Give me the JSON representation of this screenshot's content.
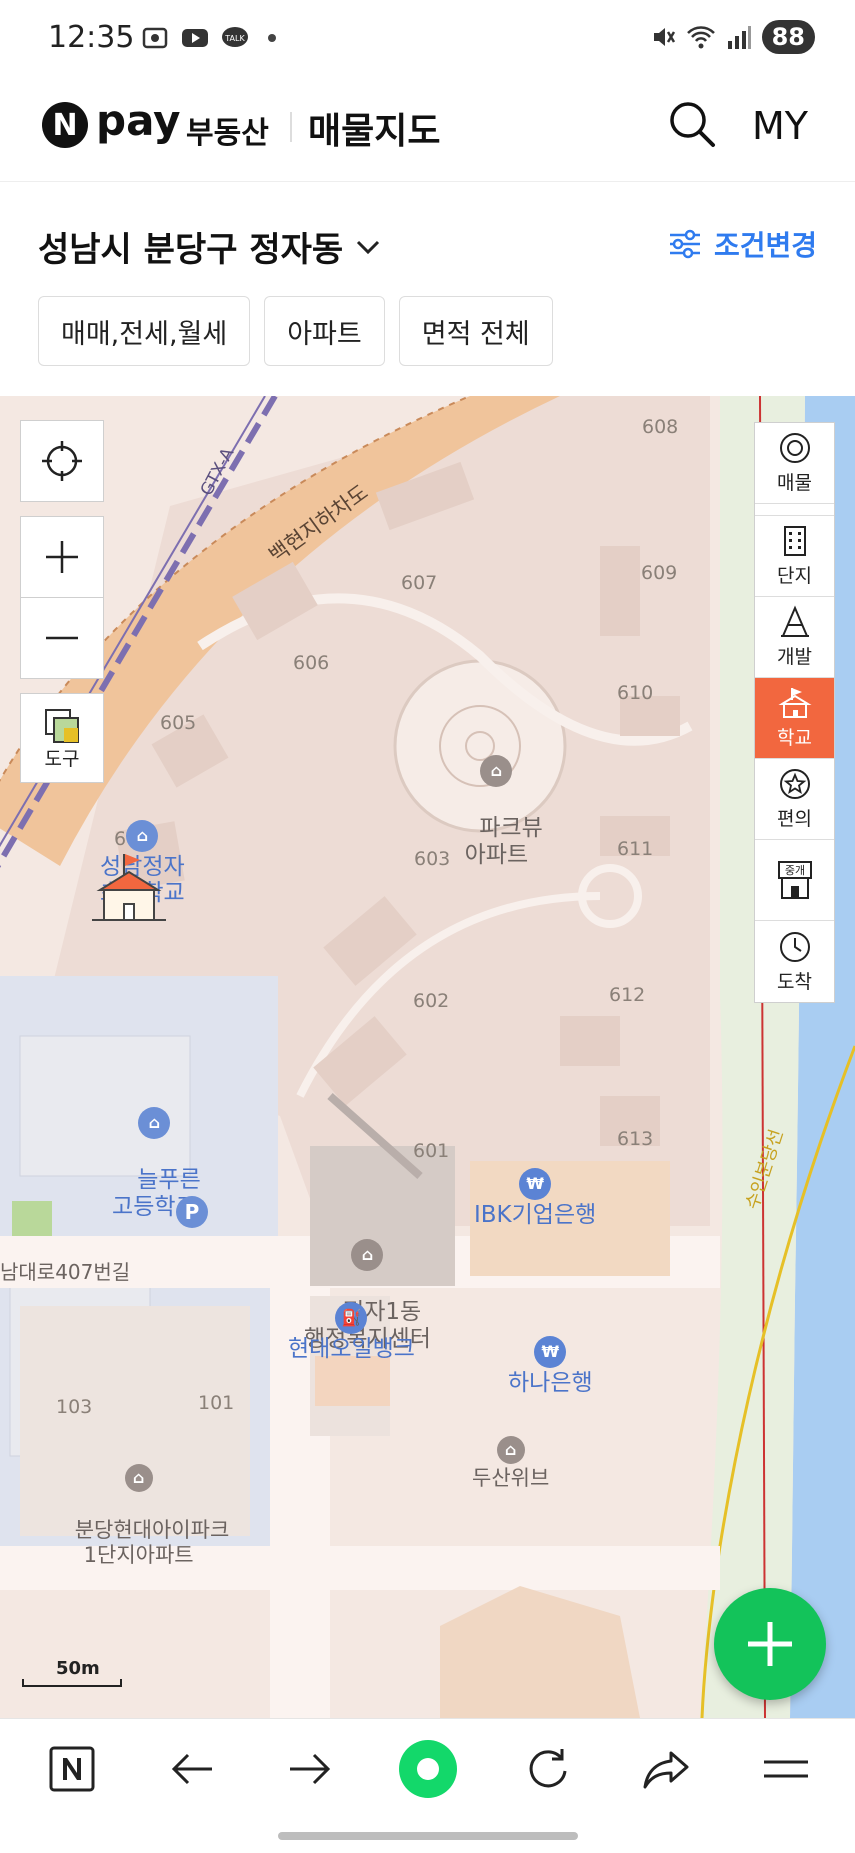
{
  "status_bar": {
    "time": "12:35",
    "battery": "88",
    "icons": [
      "screenshot-icon",
      "youtube-icon",
      "talk-icon",
      "mute-icon",
      "wifi-icon",
      "signal-icon"
    ]
  },
  "header": {
    "logo_n": "N",
    "logo_pay": "pay",
    "logo_sub": "부동산",
    "title": "매물지도",
    "my_label": "MY"
  },
  "location": {
    "title": "성남시 분당구 정자동",
    "condition_change_label": "조건변경"
  },
  "filters": [
    "매매,전세,월세",
    "아파트",
    "면적 전체"
  ],
  "map": {
    "road_label": "백현지하차도",
    "rail_label": "GTX-A",
    "building_numbers": [
      "608",
      "607",
      "609",
      "606",
      "610",
      "605",
      "604",
      "603",
      "611",
      "602",
      "612",
      "601",
      "613",
      "103",
      "101"
    ],
    "road_name": "남대로407번길",
    "pois": {
      "apartment": "파크뷰\n아파트",
      "school1_a": "성남정자",
      "school1_b": "초등학교",
      "school2": "늘푸른\n고등학교",
      "community_center": "정자1동\n행정복지센터",
      "ibk": "IBK기업은행",
      "hyundai": "현대오일뱅크",
      "hana": "하나은행",
      "hyundai_ipark": "분당현대아이파크\n1단지아파트",
      "doosan": "두산위브",
      "line_label": "수인분당선"
    },
    "controls": {
      "locate_label": "",
      "tool_label": "도구"
    },
    "scale_label": "50m",
    "accent_color": "#f2673f"
  },
  "rail": [
    {
      "label": "매물",
      "icon": "target-icon"
    },
    {
      "label": "단지",
      "icon": "building-icon"
    },
    {
      "label": "개발",
      "icon": "crane-icon"
    },
    {
      "label": "학교",
      "icon": "school-icon"
    },
    {
      "label": "편의",
      "icon": "star-icon"
    },
    {
      "label": "중개",
      "icon": "agency-icon"
    },
    {
      "label": "도착",
      "icon": "clock-icon"
    }
  ],
  "rail_box_label": "중개",
  "bottom_bar": [
    "naver-home-icon",
    "back-icon",
    "forward-icon",
    "green-dot-icon",
    "refresh-icon",
    "share-icon",
    "menu-icon"
  ]
}
